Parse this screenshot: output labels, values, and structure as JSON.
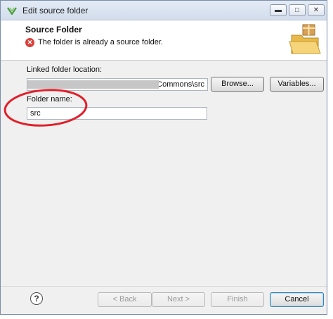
{
  "window": {
    "title": "Edit source folder"
  },
  "header": {
    "title": "Source Folder",
    "message": "The folder is already a source folder."
  },
  "form": {
    "linked_label": "Linked folder location:",
    "linked_value": "Commons\\src",
    "folder_label": "Folder name:",
    "folder_value": "src"
  },
  "buttons": {
    "browse": "Browse...",
    "variables": "Variables...",
    "back": "< Back",
    "next": "Next >",
    "finish": "Finish",
    "cancel": "Cancel",
    "help": "?"
  },
  "colors": {
    "error": "#d9413a",
    "annotation_circle": "#e0202a",
    "default_button_border": "#3c7fb1"
  },
  "icons": {
    "app": "eclipse-icon",
    "header_art": "folder-package-icon",
    "error": "error-icon"
  }
}
